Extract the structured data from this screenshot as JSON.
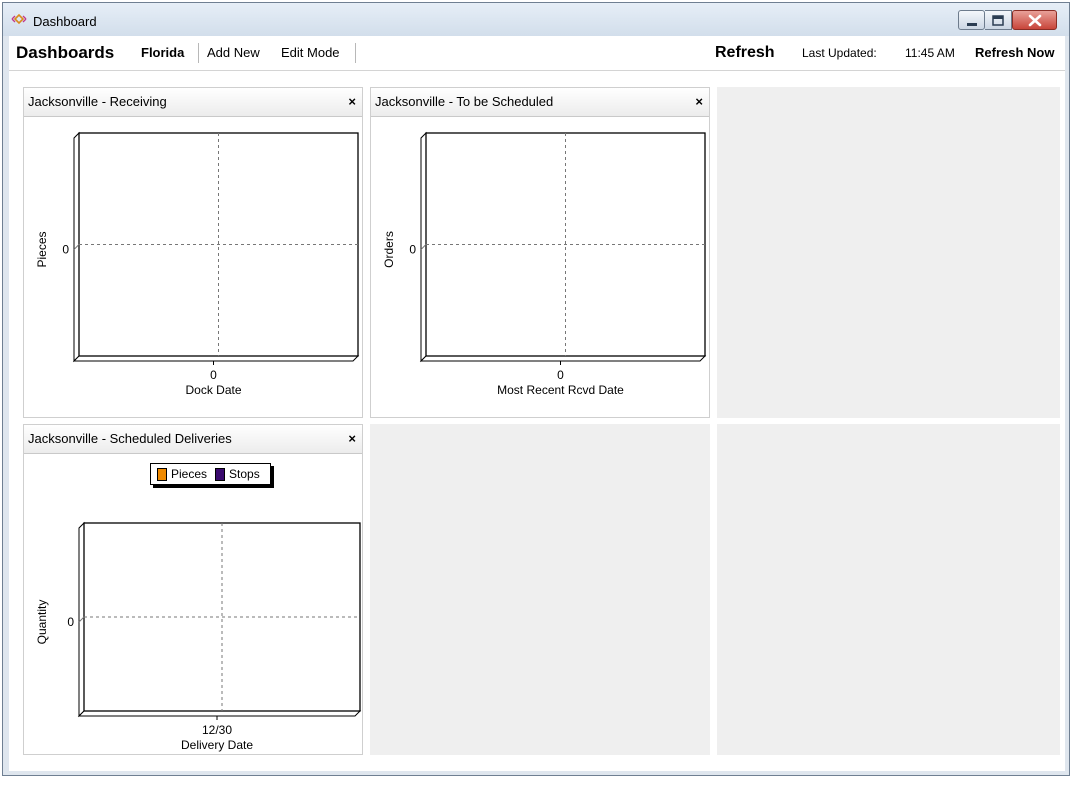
{
  "window": {
    "title": "Dashboard"
  },
  "toolbar": {
    "dashboards_label": "Dashboards",
    "current_dashboard": "Florida",
    "add_new_label": "Add New",
    "edit_mode_label": "Edit Mode",
    "refresh_label": "Refresh",
    "last_updated_label": "Last Updated:",
    "last_updated_time": "11:45 AM",
    "refresh_now_label": "Refresh Now"
  },
  "panels": [
    {
      "title": "Jacksonville - Receiving",
      "close": "×",
      "chart_data": {
        "type": "bar",
        "categories": [
          "0"
        ],
        "values": [
          0
        ],
        "xlabel": "Dock Date",
        "ylabel": "Pieces",
        "y_ticks": [
          "0"
        ],
        "grid": true
      }
    },
    {
      "title": "Jacksonville - To be Scheduled",
      "close": "×",
      "chart_data": {
        "type": "bar",
        "categories": [
          "0"
        ],
        "values": [
          0
        ],
        "xlabel": "Most Recent Rcvd Date",
        "ylabel": "Orders",
        "y_ticks": [
          "0"
        ],
        "grid": true
      }
    },
    {
      "title": "Jacksonville - Scheduled Deliveries",
      "close": "×",
      "chart_data": {
        "type": "bar",
        "categories": [
          "12/30"
        ],
        "series": [
          {
            "name": "Pieces",
            "values": [
              0
            ],
            "color": "#f08a00"
          },
          {
            "name": "Stops",
            "values": [
              0
            ],
            "color": "#3a0a6e"
          }
        ],
        "xlabel": "Delivery Date",
        "ylabel": "Quantity",
        "y_ticks": [
          "0"
        ],
        "grid": true,
        "legend": "top-center"
      }
    }
  ],
  "colors": {
    "empty_cell": "#efefef",
    "close_button": "#c8453a"
  }
}
